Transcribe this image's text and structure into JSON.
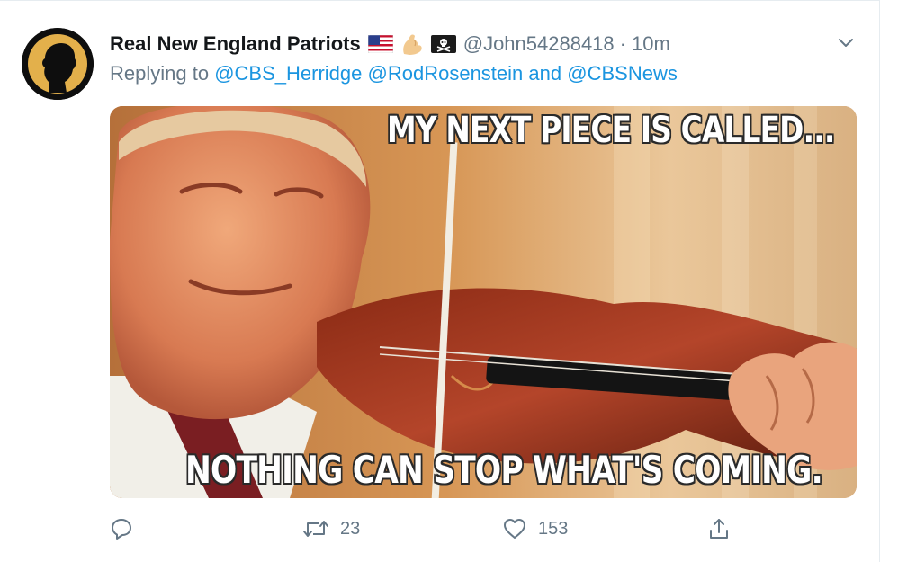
{
  "tweet": {
    "display_name": "Real New England Patriots",
    "handle": "@John54288418",
    "separator": "·",
    "time": "10m",
    "emojis": [
      "us-flag-icon",
      "flexed-bicep-icon",
      "pirate-flag-icon"
    ],
    "replying_prefix": "Replying to",
    "mentions": [
      "@CBS_Herridge",
      "@RodRosenstein",
      "@CBSNews"
    ],
    "mention_joiner": "and",
    "media": {
      "caption_top": "MY NEXT PIECE IS CALLED...",
      "caption_bottom": "NOTHING CAN STOP WHAT'S COMING."
    },
    "actions": {
      "reply_count": "",
      "retweet_count": "23",
      "like_count": "153"
    }
  },
  "colors": {
    "link": "#1b95e0",
    "muted": "#657786",
    "text": "#14171a",
    "avatar_ring": "#e3b04b"
  }
}
